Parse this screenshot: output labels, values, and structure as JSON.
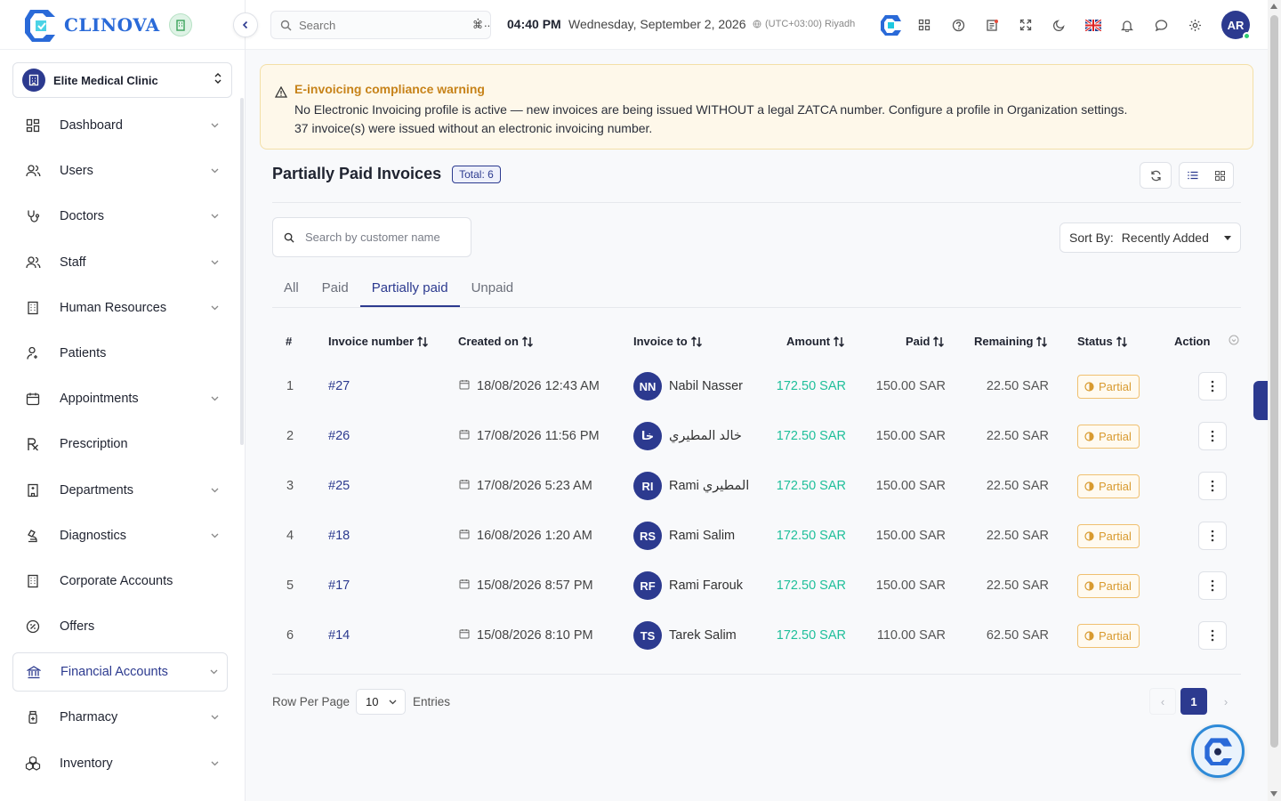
{
  "brand": {
    "name": "CLINOVA"
  },
  "clinic": {
    "name": "Elite Medical Clinic"
  },
  "sidebar": {
    "items": [
      {
        "label": "Dashboard",
        "icon": "dashboard-icon",
        "chevron": true
      },
      {
        "label": "Users",
        "icon": "users-icon",
        "chevron": true
      },
      {
        "label": "Doctors",
        "icon": "stethoscope-icon",
        "chevron": true
      },
      {
        "label": "Staff",
        "icon": "staff-icon",
        "chevron": true
      },
      {
        "label": "Human Resources",
        "icon": "building-icon",
        "chevron": true
      },
      {
        "label": "Patients",
        "icon": "patient-icon",
        "chevron": false
      },
      {
        "label": "Appointments",
        "icon": "calendar-icon",
        "chevron": true
      },
      {
        "label": "Prescription",
        "icon": "rx-icon",
        "chevron": false
      },
      {
        "label": "Departments",
        "icon": "department-icon",
        "chevron": true
      },
      {
        "label": "Diagnostics",
        "icon": "microscope-icon",
        "chevron": true
      },
      {
        "label": "Corporate Accounts",
        "icon": "corporate-icon",
        "chevron": false
      },
      {
        "label": "Offers",
        "icon": "offer-icon",
        "chevron": false
      },
      {
        "label": "Financial Accounts",
        "icon": "bank-icon",
        "chevron": true,
        "active": true
      },
      {
        "label": "Pharmacy",
        "icon": "pharmacy-icon",
        "chevron": true
      },
      {
        "label": "Inventory",
        "icon": "inventory-icon",
        "chevron": true
      }
    ]
  },
  "topbar": {
    "search_placeholder": "Search",
    "shortcut": "⌘",
    "more": "⋮..",
    "time": "04:40 PM",
    "date": "Wednesday, September 2, 2026",
    "timezone": "(UTC+03:00) Riyadh",
    "user_initials": "AR"
  },
  "alert": {
    "title": "E-invoicing compliance warning",
    "line1": "No Electronic Invoicing profile is active — new invoices are being issued WITHOUT a legal ZATCA number. Configure a profile in Organization settings.",
    "line2": "37 invoice(s) were issued without an electronic invoicing number."
  },
  "page": {
    "title": "Partially Paid Invoices",
    "total_label": "Total: 6"
  },
  "filters": {
    "search_placeholder": "Search by customer name",
    "sort_label": "Sort By:",
    "sort_value": "Recently Added"
  },
  "tabs": [
    {
      "label": "All"
    },
    {
      "label": "Paid"
    },
    {
      "label": "Partially paid",
      "active": true
    },
    {
      "label": "Unpaid"
    }
  ],
  "table": {
    "headers": {
      "idx": "#",
      "invoice": "Invoice number",
      "created": "Created on",
      "to": "Invoice to",
      "amount": "Amount",
      "paid": "Paid",
      "remaining": "Remaining",
      "status": "Status",
      "action": "Action"
    },
    "rows": [
      {
        "idx": "1",
        "invoice": "#27",
        "created": "18/08/2026 12:43 AM",
        "initials": "NN",
        "customer": "Nabil Nasser",
        "amount": "172.50 SAR",
        "paid": "150.00 SAR",
        "remaining": "22.50 SAR",
        "status": "Partial"
      },
      {
        "idx": "2",
        "invoice": "#26",
        "created": "17/08/2026 11:56 PM",
        "initials": "خا",
        "customer": "خالد المطيري",
        "amount": "172.50 SAR",
        "paid": "150.00 SAR",
        "remaining": "22.50 SAR",
        "status": "Partial"
      },
      {
        "idx": "3",
        "invoice": "#25",
        "created": "17/08/2026 5:23 AM",
        "initials": "RI",
        "customer": "Rami المطيري",
        "amount": "172.50 SAR",
        "paid": "150.00 SAR",
        "remaining": "22.50 SAR",
        "status": "Partial"
      },
      {
        "idx": "4",
        "invoice": "#18",
        "created": "16/08/2026 1:20 AM",
        "initials": "RS",
        "customer": "Rami Salim",
        "amount": "172.50 SAR",
        "paid": "150.00 SAR",
        "remaining": "22.50 SAR",
        "status": "Partial"
      },
      {
        "idx": "5",
        "invoice": "#17",
        "created": "15/08/2026 8:57 PM",
        "initials": "RF",
        "customer": "Rami Farouk",
        "amount": "172.50 SAR",
        "paid": "150.00 SAR",
        "remaining": "22.50 SAR",
        "status": "Partial"
      },
      {
        "idx": "6",
        "invoice": "#14",
        "created": "15/08/2026 8:10 PM",
        "initials": "TS",
        "customer": "Tarek Salim",
        "amount": "172.50 SAR",
        "paid": "110.00 SAR",
        "remaining": "62.50 SAR",
        "status": "Partial"
      }
    ]
  },
  "pagination": {
    "rows_label": "Row Per Page",
    "rows_value": "10",
    "entries_label": "Entries",
    "current_page": "1",
    "prev": "‹",
    "next": "›"
  },
  "colors": {
    "primary": "#2c3a8f",
    "amount": "#1fbf9a",
    "warning": "#c7831a",
    "status": "#d89a2f"
  }
}
